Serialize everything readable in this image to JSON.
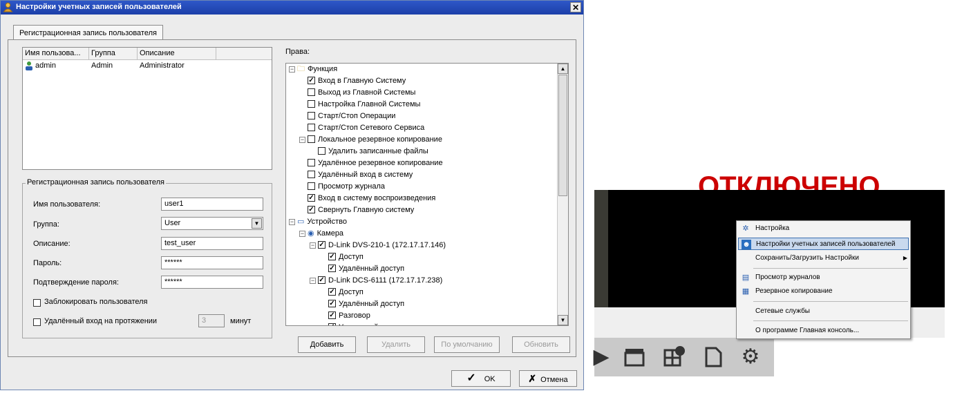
{
  "dialog": {
    "title": "Настройки учетных записей пользователей",
    "close_glyph": "✕",
    "tab_label": "Регистрационная запись пользователя"
  },
  "user_list": {
    "columns": [
      "Имя пользова...",
      "Группа",
      "Описание"
    ],
    "rows": [
      {
        "name": "admin",
        "group": "Admin",
        "description": "Administrator"
      }
    ]
  },
  "account_form": {
    "title": "Регистрационная запись пользователя",
    "username_label": "Имя пользователя:",
    "username_value": "user1",
    "group_label": "Группа:",
    "group_value": "User",
    "description_label": "Описание:",
    "description_value": "test_user",
    "password_label": "Пароль:",
    "password_value": "******",
    "confirm_label": "Подтверждение пароля:",
    "confirm_value": "******",
    "lock_label": "Заблокировать пользователя",
    "lock_checked": false,
    "remote_label": "Удалённый вход на протяжении",
    "remote_minutes": "3",
    "remote_unit": "минут",
    "remote_checked": false
  },
  "rights": {
    "label": "Права:",
    "tree": [
      {
        "label": "Функция",
        "level": 0,
        "type": "folder",
        "expander": "−"
      },
      {
        "label": "Вход в Главную Систему",
        "level": 1,
        "checked": true
      },
      {
        "label": "Выход из Главной Системы",
        "level": 1,
        "checked": false
      },
      {
        "label": "Настройка Главной Системы",
        "level": 1,
        "checked": false
      },
      {
        "label": "Старт/Стоп Операции",
        "level": 1,
        "checked": false
      },
      {
        "label": "Старт/Стоп Сетевого Сервиса",
        "level": 1,
        "checked": false
      },
      {
        "label": "Локальное резервное копирование",
        "level": 1,
        "checked": false,
        "expander": "−"
      },
      {
        "label": "Удалить записанные файлы",
        "level": 2,
        "checked": false
      },
      {
        "label": "Удалённое резервное копирование",
        "level": 1,
        "checked": false
      },
      {
        "label": "Удалённый вход в систему",
        "level": 1,
        "checked": false
      },
      {
        "label": "Просмотр журнала",
        "level": 1,
        "checked": false
      },
      {
        "label": "Вход в систему воспроизведения",
        "level": 1,
        "checked": true
      },
      {
        "label": "Свернуть Главную систему",
        "level": 1,
        "checked": true
      },
      {
        "label": "Устройство",
        "level": 0,
        "type": "monitor",
        "expander": "−"
      },
      {
        "label": "Камера",
        "level": 1,
        "type": "camera",
        "expander": "−"
      },
      {
        "label": "D-Link DVS-210-1 (172.17.17.146)",
        "level": 2,
        "checked": true,
        "expander": "−"
      },
      {
        "label": "Доступ",
        "level": 3,
        "checked": true
      },
      {
        "label": "Удалённый доступ",
        "level": 3,
        "checked": true
      },
      {
        "label": "D-Link DCS-6111 (172.17.17.238)",
        "level": 2,
        "checked": true,
        "expander": "−"
      },
      {
        "label": "Доступ",
        "level": 3,
        "checked": true
      },
      {
        "label": "Удалённый доступ",
        "level": 3,
        "checked": true
      },
      {
        "label": "Разговор",
        "level": 3,
        "checked": true
      },
      {
        "label": "Удаленный разговор",
        "level": 3,
        "checked": true
      }
    ]
  },
  "buttons": {
    "add": "Добавить",
    "delete": "Удалить",
    "default": "По умолчанию",
    "update": "Обновить",
    "ok": "OK",
    "cancel": "Отмена"
  },
  "context_menu": {
    "items": [
      {
        "label": "Настройка",
        "icon": "gear-icon",
        "selected": false
      },
      {
        "label": "Настройки учетных записей пользователей",
        "icon": "user-icon",
        "selected": true
      },
      {
        "label": "Сохранить/Загрузить Настройки",
        "icon": "",
        "submenu": true
      },
      {
        "label": "Просмотр журналов",
        "icon": "log-icon"
      },
      {
        "label": "Резервное копирование",
        "icon": "backup-icon"
      },
      {
        "label": "Сетевые службы",
        "icon": ""
      },
      {
        "label": "О программе Главная консоль...",
        "icon": ""
      }
    ]
  },
  "colors": {
    "title_bar": "#1c3fa8",
    "overlay_text": "#cc0000",
    "menu_selection": "#c9d9ee"
  }
}
